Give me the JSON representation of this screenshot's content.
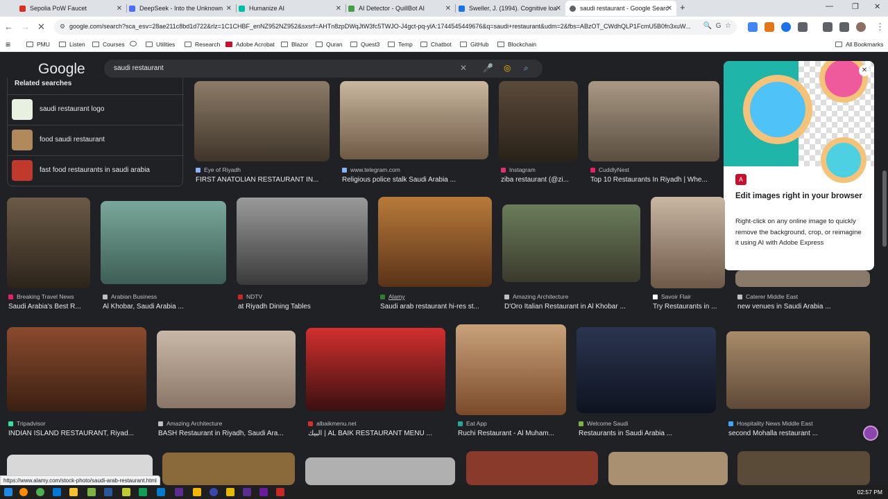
{
  "tabs": [
    {
      "label": "Sepolia PoW Faucet",
      "color": "#d93025"
    },
    {
      "label": "DeepSeek - Into the Unknown",
      "color": "#4d6bfe"
    },
    {
      "label": "Humanize AI",
      "color": "#00bfa5"
    },
    {
      "label": "AI Detector - QuillBot AI",
      "color": "#43a047"
    },
    {
      "label": "Sweller, J. (1994). Cognitive loa",
      "color": "#1a73e8"
    },
    {
      "label": "saudi restaurant - Google Searc",
      "color": "#5f6368"
    }
  ],
  "url": "google.com/search?sca_esv=28ae211c8bd1d722&rlz=1C1CHBF_enNZ952NZ952&sxsrf=AHTn8zpDWqJtW3fc5TWJO-J4gct-pq-ylA:1744545449676&q=saudi+restaurant&udm=2&fbs=ABzOT_CWdhQLP1FcmU5B0fn3xuW...",
  "bookmarks": [
    "PMU",
    "Listen",
    "Courses",
    "Utilities",
    "Research",
    "Adobe Acrobat",
    "Blazor",
    "Quran",
    "Quest3",
    "Temp",
    "Chatbot",
    "GitHub",
    "Blockchain"
  ],
  "all_bookmarks": "All Bookmarks",
  "logo": "Google",
  "search_query": "saudi restaurant",
  "related": {
    "title": "Related searches",
    "items": [
      "saudi restaurant logo",
      "food saudi restaurant",
      "fast food restaurants in saudi arabia"
    ]
  },
  "results_row1": [
    {
      "source": "Eye of Riyadh",
      "title": "FIRST ANATOLIAN RESTAURANT IN..."
    },
    {
      "source": "www.telegram.com",
      "title": "Religious police stalk Saudi Arabia ..."
    },
    {
      "source": "Instagram",
      "title": "ziba restaurant (@zi..."
    },
    {
      "source": "CuddlyNest",
      "title": "Top 10 Restaurants In Riyadh | Whe..."
    }
  ],
  "results_row2": [
    {
      "source": "Breaking Travel News",
      "title": "Saudi Arabia's Best R..."
    },
    {
      "source": "Arabian Business",
      "title": "Al Khobar, Saudi Arabia ..."
    },
    {
      "source": "NDTV",
      "title": "at Riyadh Dining Tables"
    },
    {
      "source": "Alamy",
      "title": "Saudi arab restaurant hi-res st..."
    },
    {
      "source": "Amazing Architecture",
      "title": "D'Oro Italian Restaurant in Al Khobar ..."
    },
    {
      "source": "Savoir Flair",
      "title": "Try Restaurants in ..."
    },
    {
      "source": "Caterer Middle East",
      "title": "new venues in Saudi Arabia ..."
    }
  ],
  "results_row3": [
    {
      "source": "Tripadvisor",
      "title": "INDIAN ISLAND RESTAURANT, Riyad..."
    },
    {
      "source": "Amazing Architecture",
      "title": "BASH Restaurant in Riyadh, Saudi Ara..."
    },
    {
      "source": "albaikmenu.net",
      "title": "البيك | AL BAIK RESTAURANT MENU ..."
    },
    {
      "source": "Eat App",
      "title": "Ruchi Restaurant - Al Muham..."
    },
    {
      "source": "Welcome Saudi",
      "title": "Restaurants in Saudi Arabia ..."
    },
    {
      "source": "Hospitality News Middle East",
      "title": "second Mohalla restaurant ..."
    }
  ],
  "popup": {
    "title": "Edit images right in your browser",
    "body": "Right-click on any online image to quickly remove the background, crop, or reimagine it using AI with Adobe Express"
  },
  "status_url": "https://www.alamy.com/stock-photo/saudi-arab-restaurant.html",
  "clock": "02:57 PM"
}
